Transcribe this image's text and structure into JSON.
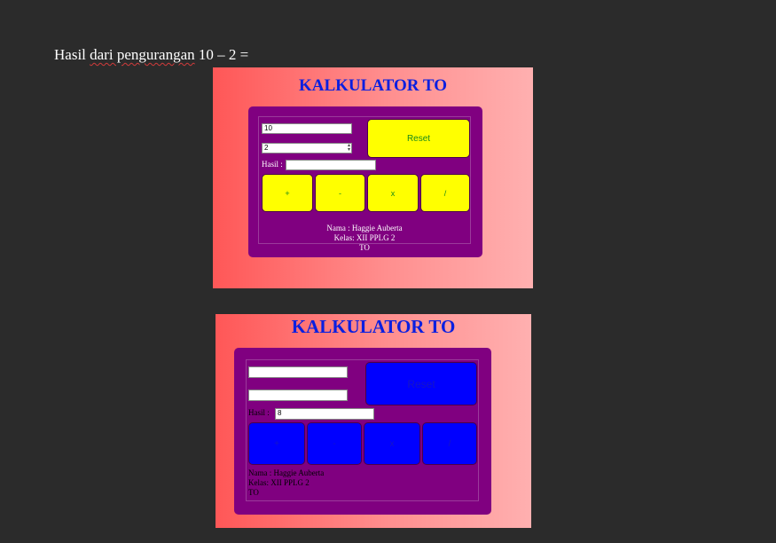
{
  "document": {
    "question_prefix": "Hasil ",
    "question_underlined": "dari pengurangan",
    "question_suffix": " 10 – 2 ="
  },
  "calc1": {
    "title": "KALKULATOR TO",
    "input1": "10",
    "input2": "2",
    "hasil_label": "Hasil :",
    "hasil_value": "",
    "reset": "Reset",
    "ops": [
      "+",
      "-",
      "x",
      "/"
    ],
    "footer": [
      "Nama : Haggie Auberta",
      "Kelas: XII PPLG 2",
      "TO"
    ],
    "colors": {
      "button": "#ffff00",
      "panel": "#800080",
      "title": "#0a1fe0"
    }
  },
  "calc2": {
    "title": "KALKULATOR TO",
    "input1": "",
    "input2": "",
    "hasil_label": "Hasil :",
    "hasil_value": "8",
    "reset": "Reset",
    "ops": [
      "+",
      "-",
      "x",
      "/"
    ],
    "footer": [
      "Nama : Haggie Auberta",
      "Kelas: XII PPLG 2",
      "TO"
    ],
    "colors": {
      "button": "#0000ff",
      "panel": "#800080",
      "title": "#0a1fe0"
    }
  }
}
